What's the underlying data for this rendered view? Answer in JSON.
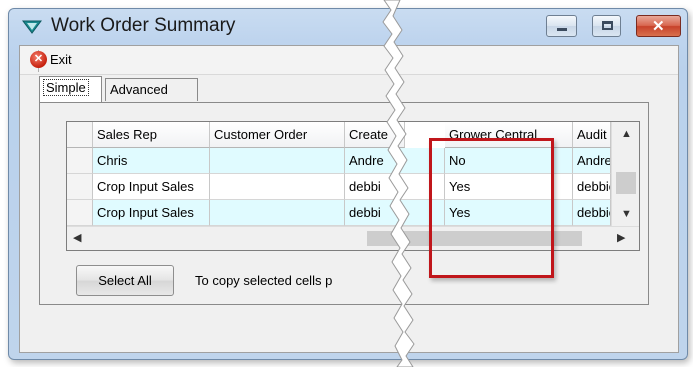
{
  "window": {
    "title": "Work Order Summary",
    "controls": {
      "minimize": "minimize",
      "maximize": "maximize",
      "close": "close"
    }
  },
  "toolbar": {
    "exit_label": "Exit"
  },
  "tabs": [
    {
      "label": "Simple",
      "active": true
    },
    {
      "label": "Advanced",
      "active": false
    }
  ],
  "grid": {
    "columns": [
      "Sales Rep",
      "Customer Order",
      "Create",
      "Grower Central",
      "Audit C"
    ],
    "rows": [
      {
        "sales_rep": "Chris",
        "customer_order": "",
        "created": "Andre",
        "grower_central": "No",
        "audit": "Andrev"
      },
      {
        "sales_rep": "Crop Input Sales",
        "customer_order": "",
        "created": "debbi",
        "grower_central": "Yes",
        "audit": "debbie"
      },
      {
        "sales_rep": "Crop Input Sales",
        "customer_order": "",
        "created": "debbi",
        "grower_central": "Yes",
        "audit": "debbie"
      }
    ]
  },
  "footer": {
    "select_all_label": "Select All",
    "copy_note": "To copy selected cells p"
  },
  "colors": {
    "highlight_box": "#c0161b",
    "alt_row": "#e0fbff"
  }
}
